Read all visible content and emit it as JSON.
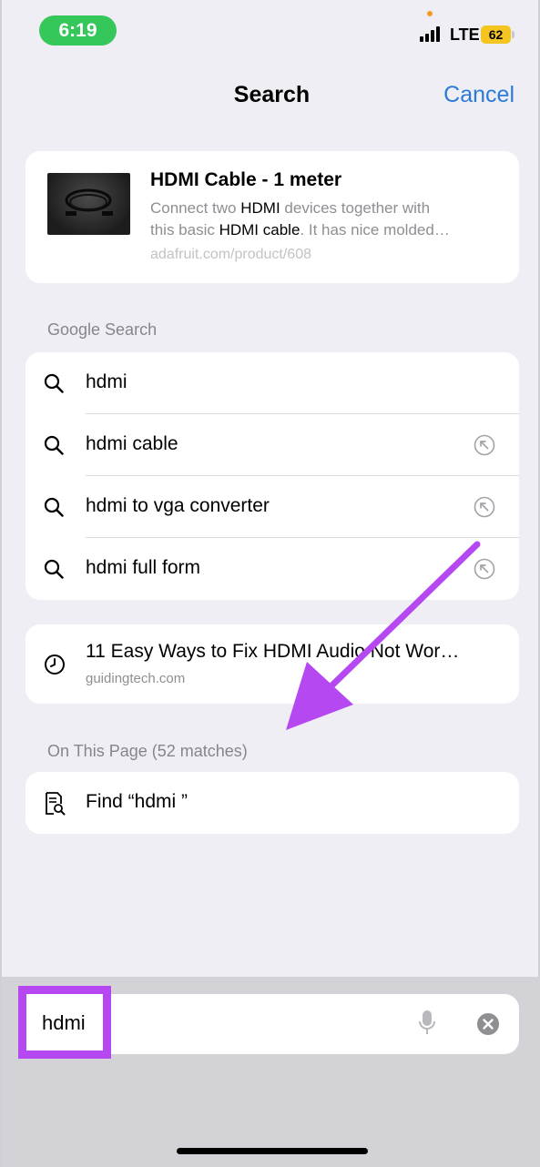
{
  "status": {
    "time": "6:19",
    "network": "LTE",
    "battery": "62"
  },
  "nav": {
    "title": "Search",
    "cancel_label": "Cancel"
  },
  "top_hit": {
    "title": "HDMI Cable - 1 meter",
    "desc_line1_pre": "Connect two ",
    "desc_line1_bold": "HDMI",
    "desc_line1_post": " devices together with",
    "desc_line2_pre": "this basic ",
    "desc_line2_bold": "HDMI cable",
    "desc_line2_post": ". It has nice molded…",
    "url": "adafruit.com/product/608"
  },
  "google": {
    "section_label": "Google Search",
    "items": [
      {
        "label": "hdmi"
      },
      {
        "label": "hdmi cable"
      },
      {
        "label": "hdmi to vga converter"
      },
      {
        "label": "hdmi full form"
      }
    ]
  },
  "history": {
    "title": "11 Easy Ways to Fix HDMI Audio Not Wor…",
    "site": "guidingtech.com"
  },
  "on_page": {
    "section_label": "On This Page (52 matches)",
    "find_label": "Find “hdmi ”"
  },
  "search_field": {
    "value": "hdmi"
  },
  "colors": {
    "accent": "#2a7bd6",
    "annotation": "#b548f0",
    "time_pill": "#35c759",
    "battery": "#f4c521"
  }
}
